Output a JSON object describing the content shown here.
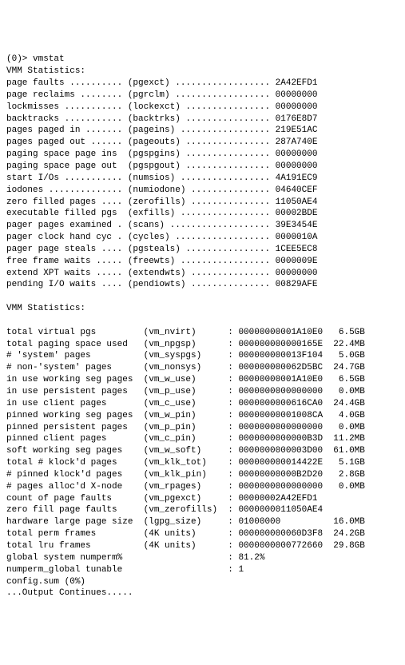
{
  "prompt": "(0)> vmstat",
  "section1_title": "VMM Statistics:",
  "section1": [
    {
      "label": "page faults",
      "p": "pgexct",
      "v": "2A42EFD1"
    },
    {
      "label": "page reclaims",
      "p": "pgrclm",
      "v": "00000000"
    },
    {
      "label": "lockmisses",
      "p": "lockexct",
      "v": "00000000"
    },
    {
      "label": "backtracks",
      "p": "backtrks",
      "v": "0176E8D7"
    },
    {
      "label": "pages paged in",
      "p": "pageins",
      "v": "219E51AC"
    },
    {
      "label": "pages paged out",
      "p": "pageouts",
      "v": "287A740E"
    },
    {
      "label": "paging space page ins",
      "p": "pgspgins",
      "v": "00000000"
    },
    {
      "label": "paging space page out",
      "p": "pgspgout",
      "v": "00000000"
    },
    {
      "label": "start I/Os",
      "p": "numsios",
      "v": "4A191EC9"
    },
    {
      "label": "iodones",
      "p": "numiodone",
      "v": "04640CEF"
    },
    {
      "label": "zero filled pages",
      "p": "zerofills",
      "v": "11050AE4"
    },
    {
      "label": "executable filled pgs",
      "p": "exfills",
      "v": "00002BDE"
    },
    {
      "label": "pager pages examined",
      "p": "scans",
      "v": "39E3454E"
    },
    {
      "label": "pager clock hand cyc",
      "p": "cycles",
      "v": "0000010A"
    },
    {
      "label": "pager page steals",
      "p": "pgsteals",
      "v": "1CEE5EC8"
    },
    {
      "label": "free frame waits",
      "p": "freewts",
      "v": "0000009E"
    },
    {
      "label": "extend XPT waits",
      "p": "extendwts",
      "v": "00000000"
    },
    {
      "label": "pending I/O waits",
      "p": "pendiowts",
      "v": "00829AFE"
    }
  ],
  "section2_title": "VMM Statistics:",
  "section2": [
    {
      "label": "total virtual pgs",
      "p": "vm_nvirt",
      "hex": "00000000001A10E0",
      "hr": "6.5GB"
    },
    {
      "label": "total paging space used",
      "p": "vm_npgsp",
      "hex": "000000000000165E",
      "hr": "22.4MB"
    },
    {
      "label": "# 'system' pages",
      "p": "vm_syspgs",
      "hex": "000000000013F104",
      "hr": "5.0GB"
    },
    {
      "label": "# non-'system' pages",
      "p": "vm_nonsys",
      "hex": "000000000062D5BC",
      "hr": "24.7GB"
    },
    {
      "label": "in use working seg pages",
      "p": "vm_w_use",
      "hex": "00000000001A10E0",
      "hr": "6.5GB"
    },
    {
      "label": "in use persistent pages",
      "p": "vm_p_use",
      "hex": "0000000000000000",
      "hr": "0.0MB"
    },
    {
      "label": "in use client pages",
      "p": "vm_c_use",
      "hex": "0000000000616CA0",
      "hr": "24.4GB"
    },
    {
      "label": "pinned working seg pages",
      "p": "vm_w_pin",
      "hex": "00000000001008CA",
      "hr": "4.0GB"
    },
    {
      "label": "pinned persistent pages",
      "p": "vm_p_pin",
      "hex": "0000000000000000",
      "hr": "0.0MB"
    },
    {
      "label": "pinned client pages",
      "p": "vm_c_pin",
      "hex": "0000000000000B3D",
      "hr": "11.2MB"
    },
    {
      "label": "soft working seg pages",
      "p": "vm_w_soft",
      "hex": "0000000000003D00",
      "hr": "61.0MB"
    },
    {
      "label": "total # klock'd pages",
      "p": "vm_klk_tot",
      "hex": "000000000014422E",
      "hr": "5.1GB"
    },
    {
      "label": "# pinned klock'd pages",
      "p": "vm_klk_pin",
      "hex": "00000000000B2D20",
      "hr": "2.8GB"
    },
    {
      "label": "# pages alloc'd X-node",
      "p": "vm_rpages",
      "hex": "0000000000000000",
      "hr": "0.0MB"
    },
    {
      "label": "count of page faults",
      "p": "vm_pgexct",
      "hex": "00000002A42EFD1",
      "hr": ""
    },
    {
      "label": "zero fill page faults",
      "p": "vm_zerofills",
      "hex": "0000000011050AE4",
      "hr": ""
    },
    {
      "label": "hardware large page size",
      "p": "lgpg_size",
      "hex": "01000000",
      "hr": "16.0MB"
    },
    {
      "label": "total perm frames",
      "p": "4K units",
      "hex": "000000000060D3F8",
      "hr": "24.2GB"
    },
    {
      "label": "total lru frames",
      "p": "4K units",
      "hex": "0000000000772660",
      "hr": "29.8GB"
    },
    {
      "label": "global system numperm%",
      "p": "",
      "hex": "81.2%",
      "hr": ""
    },
    {
      "label": "numperm_global tunable",
      "p": "",
      "hex": "1",
      "hr": ""
    }
  ],
  "footer1": "config.sum (0%)",
  "footer2": "...Output Continues....."
}
